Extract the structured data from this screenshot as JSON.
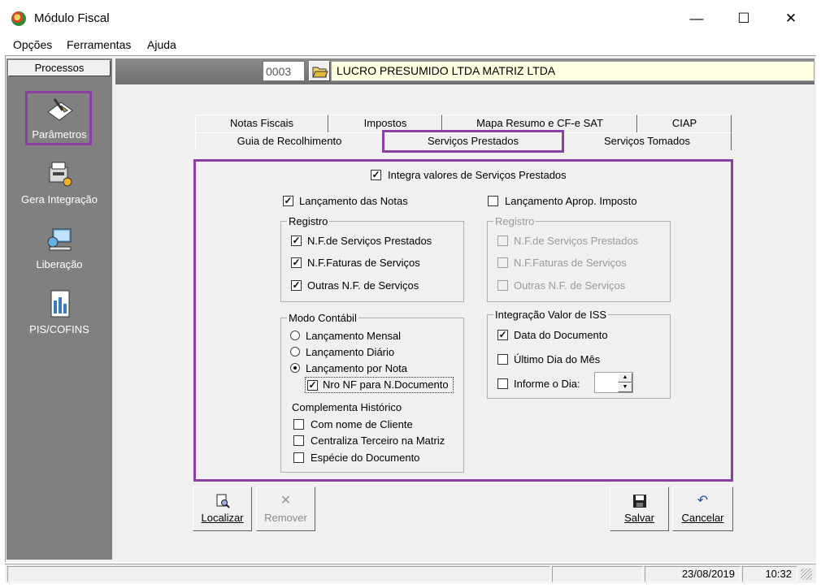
{
  "window": {
    "title": "Módulo Fiscal"
  },
  "window_buttons": {
    "minimize": "—",
    "maximize": "☐",
    "close": "✕"
  },
  "menu": [
    "Opções",
    "Ferramentas",
    "Ajuda"
  ],
  "sidebar": {
    "header": "Processos",
    "items": [
      {
        "label": "Parâmetros",
        "icon": "parameters-icon"
      },
      {
        "label": "Gera Integração",
        "icon": "integration-icon"
      },
      {
        "label": "Liberação",
        "icon": "release-icon"
      },
      {
        "label": "PIS/COFINS",
        "icon": "pis-cofins-icon"
      }
    ]
  },
  "company": {
    "code": "0003",
    "name": "LUCRO PRESUMIDO LTDA MATRIZ LTDA"
  },
  "tabs_row1": [
    "Notas Fiscais",
    "Impostos",
    "Mapa Resumo e CF-e SAT",
    "CIAP"
  ],
  "tabs_row2": [
    "Guia de Recolhimento",
    "Serviços Prestados",
    "Serviços Tomados"
  ],
  "active_tab": "Serviços Prestados",
  "page": {
    "integra": {
      "label": "Integra valores de Serviços Prestados",
      "checked": true
    },
    "left": {
      "lancamento": {
        "label": "Lançamento das Notas",
        "checked": true
      },
      "registro_title": "Registro",
      "registro": [
        {
          "label": "N.F.de Serviços Prestados",
          "checked": true
        },
        {
          "label": "N.F.Faturas de Serviços",
          "checked": true
        },
        {
          "label": "Outras N.F. de Serviços",
          "checked": true
        }
      ],
      "modo_title": "Modo Contábil",
      "modo": [
        {
          "label": "Lançamento Mensal",
          "selected": false
        },
        {
          "label": "Lançamento Diário",
          "selected": false
        },
        {
          "label": "Lançamento por Nota",
          "selected": true
        }
      ],
      "nro_nf": {
        "label": "Nro NF para N.Documento",
        "checked": true
      },
      "complementa_title": "Complementa Histórico",
      "complementa": [
        {
          "label": "Com nome de Cliente",
          "checked": false
        },
        {
          "label": "Centraliza Terceiro na Matriz",
          "checked": false
        },
        {
          "label": "Espécie do Documento",
          "checked": false
        }
      ]
    },
    "right": {
      "lancamento": {
        "label": "Lançamento Aprop. Imposto",
        "checked": false
      },
      "registro_title": "Registro",
      "registro": [
        {
          "label": "N.F.de Serviços Prestados",
          "checked": false
        },
        {
          "label": "N.F.Faturas de Serviços",
          "checked": false
        },
        {
          "label": "Outras N.F. de Serviços",
          "checked": false
        }
      ],
      "iss_title": "Integração Valor de ISS",
      "iss": [
        {
          "label": "Data do Documento",
          "checked": true
        },
        {
          "label": "Último Dia do Mês",
          "checked": false
        },
        {
          "label": "Informe o Dia:",
          "checked": false
        }
      ]
    }
  },
  "buttons": {
    "localizar": "Localizar",
    "remover": "Remover",
    "salvar": "Salvar",
    "cancelar": "Cancelar"
  },
  "status": {
    "date": "23/08/2019",
    "time": "10:32"
  },
  "colors": {
    "highlight": "#8b3fa0",
    "sidebar": "#808080",
    "company_bg": "#ffffe1"
  }
}
